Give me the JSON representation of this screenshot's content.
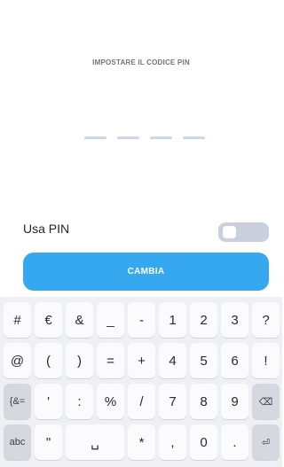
{
  "header": {
    "title": "IMPOSTARE IL CODICE PIN"
  },
  "pin": {
    "length": 4,
    "entered": 0
  },
  "settings": {
    "use_pin_label": "Usa PIN",
    "use_pin_enabled": false
  },
  "actions": {
    "change_label": "CAMBIA"
  },
  "keyboard": {
    "row1": [
      "#",
      "€",
      "&",
      "_",
      "-",
      "1",
      "2",
      "3",
      "?"
    ],
    "row2": [
      "@",
      "(",
      ")",
      "=",
      "+",
      "4",
      "5",
      "6",
      "!"
    ],
    "row3": [
      "{&=",
      "'",
      ":",
      "%",
      "/",
      "7",
      "8",
      "9",
      "⌫"
    ],
    "row4": [
      "abc",
      "\"",
      "␣",
      "*",
      ",",
      "0",
      ".",
      "⏎"
    ]
  }
}
